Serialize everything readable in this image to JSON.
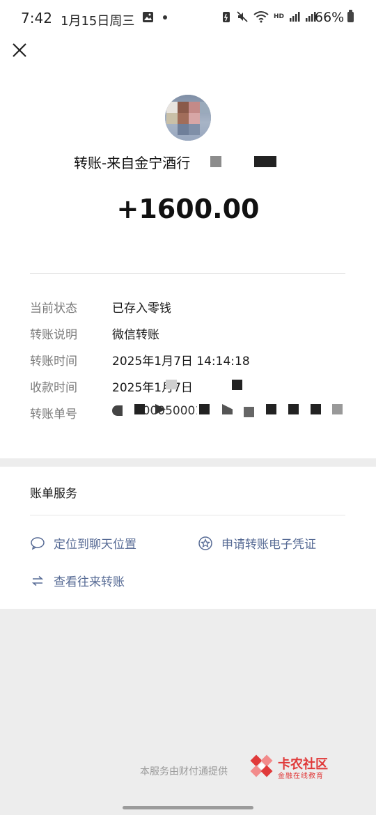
{
  "status_bar": {
    "time": "7:42",
    "date": "1月15日周三",
    "battery": "66%"
  },
  "colors": {
    "link": "#576b95",
    "background": "#ededed",
    "card": "#ffffff"
  },
  "icons": {
    "close": "close-icon",
    "chat": "chat-bubble-icon",
    "voucher": "star-circle-icon",
    "transfers": "swap-arrows-icon"
  },
  "transfer": {
    "title": "转账-来自金宁酒行",
    "amount": "+1600.00"
  },
  "details": [
    {
      "label": "当前状态",
      "value": "已存入零钱"
    },
    {
      "label": "转账说明",
      "value": "微信转账"
    },
    {
      "label": "转账时间",
      "value": "2025年1月7日 14:14:18"
    },
    {
      "label": "收款时间",
      "value": "2025年1月7日"
    },
    {
      "label": "转账单号",
      "value": "1000050001202"
    }
  ],
  "services": {
    "title": "账单服务",
    "links": {
      "locate_chat": "定位到聊天位置",
      "apply_voucher": "申请转账电子凭证",
      "view_transfers": "查看往来转账"
    }
  },
  "footer": {
    "provider": "本服务由财付通提供",
    "watermark_main": "卡农社区",
    "watermark_sub": "金融在线教育"
  }
}
